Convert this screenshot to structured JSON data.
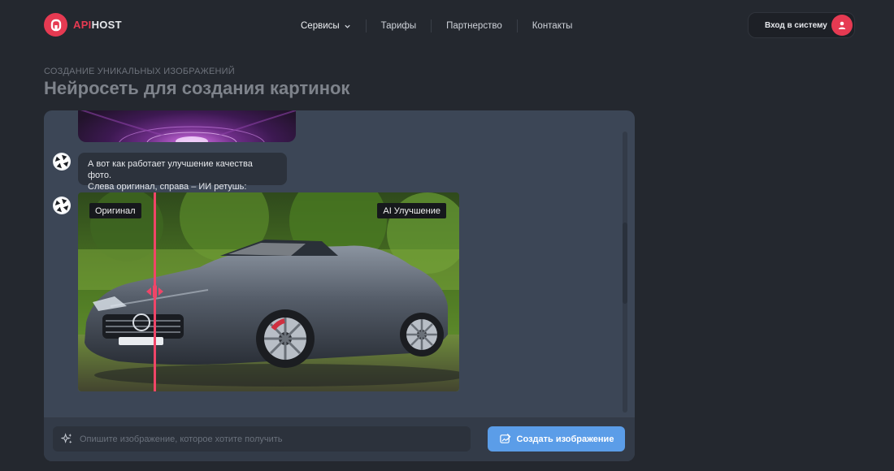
{
  "brand": {
    "name_accent": "API",
    "name_rest": "HOST",
    "accent": "#e63a52"
  },
  "nav": [
    {
      "label": "Сервисы",
      "has_dropdown": true
    },
    {
      "label": "Тарифы"
    },
    {
      "label": "Партнерство"
    },
    {
      "label": "Контакты"
    }
  ],
  "auth": {
    "login_label": "Вход в систему",
    "avatar_icon": "user-icon"
  },
  "page": {
    "subtitle": "СОЗДАНИЕ УНИКАЛЬНЫХ ИЗОБРАЖЕНИЙ",
    "title": "Нейросеть для создания картинок"
  },
  "chat": {
    "messages": [
      {
        "type": "text",
        "lines": [
          "А вот как работает улучшение качества фото.",
          "Слева оригинал, справа – ИИ ретушь:"
        ]
      },
      {
        "type": "compare-image",
        "left_label": "Оригинал",
        "right_label": "AI Улучшение"
      }
    ]
  },
  "composer": {
    "placeholder": "Опишите изображение, которое хотите получить",
    "submit_label": "Создать изображение",
    "button_color": "#5b9de8"
  }
}
